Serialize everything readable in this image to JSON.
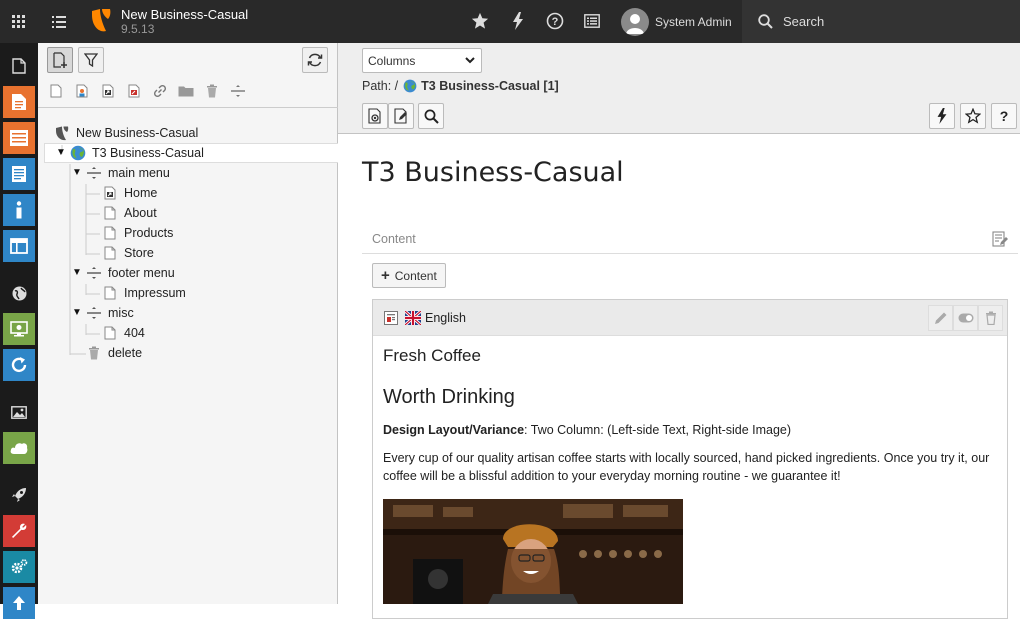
{
  "topbar": {
    "site_name": "New Business-Casual",
    "version": "9.5.13",
    "user_name": "System Admin",
    "search_label": "Search"
  },
  "module_menu": {
    "items": [
      "page",
      "view",
      "list",
      "form",
      "info",
      "template",
      "workspaces",
      "sites",
      "reports",
      "filelist",
      "extensions",
      "install",
      "maintenance",
      "settings",
      "upgrade"
    ]
  },
  "page_tree": {
    "nodes": [
      {
        "label": "New Business-Casual",
        "icon": "typo3-root-icon"
      },
      {
        "label": "T3 Business-Casual",
        "icon": "globe-icon"
      },
      {
        "label": "main menu",
        "icon": "menu-separator-icon"
      },
      {
        "label": "Home",
        "icon": "page-shortcut-icon"
      },
      {
        "label": "About",
        "icon": "page-icon"
      },
      {
        "label": "Products",
        "icon": "page-icon"
      },
      {
        "label": "Store",
        "icon": "page-icon"
      },
      {
        "label": "footer menu",
        "icon": "menu-separator-icon"
      },
      {
        "label": "Impressum",
        "icon": "page-icon"
      },
      {
        "label": "misc",
        "icon": "menu-separator-icon"
      },
      {
        "label": "404",
        "icon": "page-icon"
      },
      {
        "label": "delete",
        "icon": "recycler-icon"
      }
    ]
  },
  "docheader": {
    "view_select": "Columns",
    "path_label": "Path: /",
    "path_page": "T3 Business-Casual [1]"
  },
  "page": {
    "title": "T3 Business-Casual",
    "column_label": "Content",
    "add_content_label": "Content",
    "language": "English",
    "content": {
      "header": "Fresh Coffee",
      "subheader": "Worth Drinking",
      "design_label": "Design Layout/Variance",
      "design_value": ": Two Column: (Left-side Text, Right-side Image)",
      "body": "Every cup of our quality artisan coffee starts with locally sourced, hand picked ingredients. Once you try it, our coffee will be a blissful addition to your everyday morning routine - we guarantee it!"
    }
  },
  "colors": {
    "topbar": "#292929",
    "module_bar": "#1b1b1b",
    "typo3_orange": "#ff8700",
    "mod_orange": "#e8722f",
    "mod_blue": "#2f86c7",
    "mod_green": "#79a548",
    "mod_red": "#d33c36",
    "mod_teal": "#1a8aa4"
  }
}
